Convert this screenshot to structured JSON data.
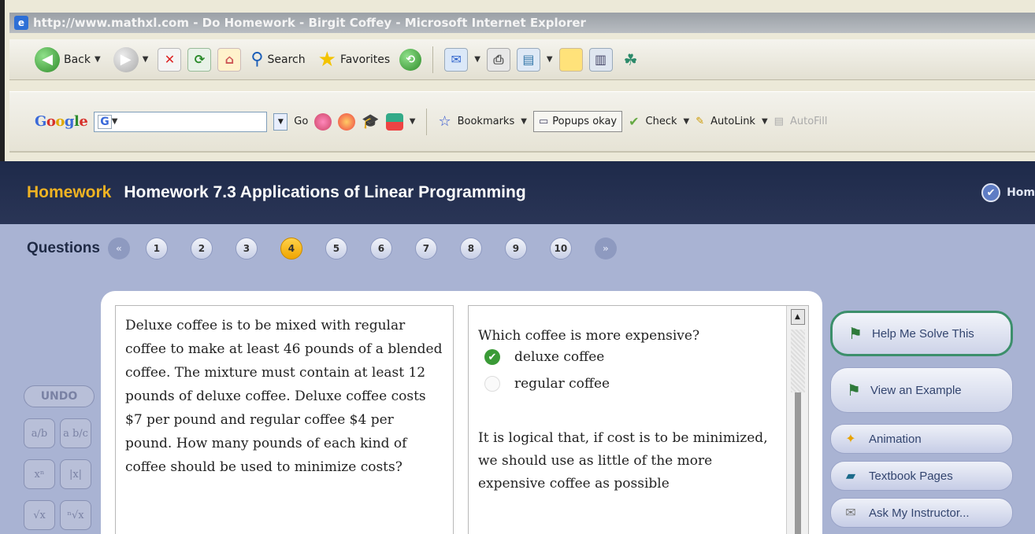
{
  "browser": {
    "title": "http://www.mathxl.com - Do Homework - Birgit Coffey - Microsoft Internet Explorer",
    "toolbar": {
      "back_label": "Back",
      "search_label": "Search",
      "favorites_label": "Favorites"
    },
    "googlebar": {
      "logo": "Google",
      "input_value": "",
      "go_label": "Go",
      "bookmarks_label": "Bookmarks",
      "popups_label": "Popups okay",
      "check_label": "Check",
      "autolink_label": "AutoLink",
      "autofill_label": "AutoFill"
    }
  },
  "app": {
    "section_label": "Homework",
    "title": "Homework 7.3 Applications of Linear Programming",
    "home_label": "Hom",
    "questions_label": "Questions",
    "questions": [
      "1",
      "2",
      "3",
      "4",
      "5",
      "6",
      "7",
      "8",
      "9",
      "10"
    ],
    "active_question": "4",
    "prev_symbol": "«",
    "next_symbol": "»"
  },
  "palette": {
    "undo_label": "UNDO",
    "buttons": [
      "a/b",
      "a b/c",
      "xⁿ",
      "|x|",
      "√x",
      "ⁿ√x"
    ]
  },
  "problem": {
    "text": "Deluxe coffee is to be mixed with regular coffee to make at least 46 pounds of a blended coffee. The mixture must contain at least 12 pounds of deluxe coffee. Deluxe coffee costs $7 per pound and regular coffee $4 per pound. How many pounds of each kind of coffee should be used to minimize costs?"
  },
  "answer": {
    "question": "Which coffee is more expensive?",
    "choices": [
      {
        "label": "deluxe coffee",
        "selected": true
      },
      {
        "label": "regular coffee",
        "selected": false
      }
    ],
    "explanation": "It is logical that, if cost is to be minimized, we should use as little of the more expensive coffee as possible"
  },
  "tools": {
    "help_label": "Help Me Solve This",
    "example_label": "View an Example",
    "animation_label": "Animation",
    "textbook_label": "Textbook Pages",
    "instructor_label": "Ask My Instructor..."
  },
  "colors": {
    "header_bg": "#1e2a4a",
    "homework_accent": "#f0b323",
    "app_bg": "#a9b3d3",
    "active_question": "#f0a500",
    "check_green": "#3a9a36"
  }
}
